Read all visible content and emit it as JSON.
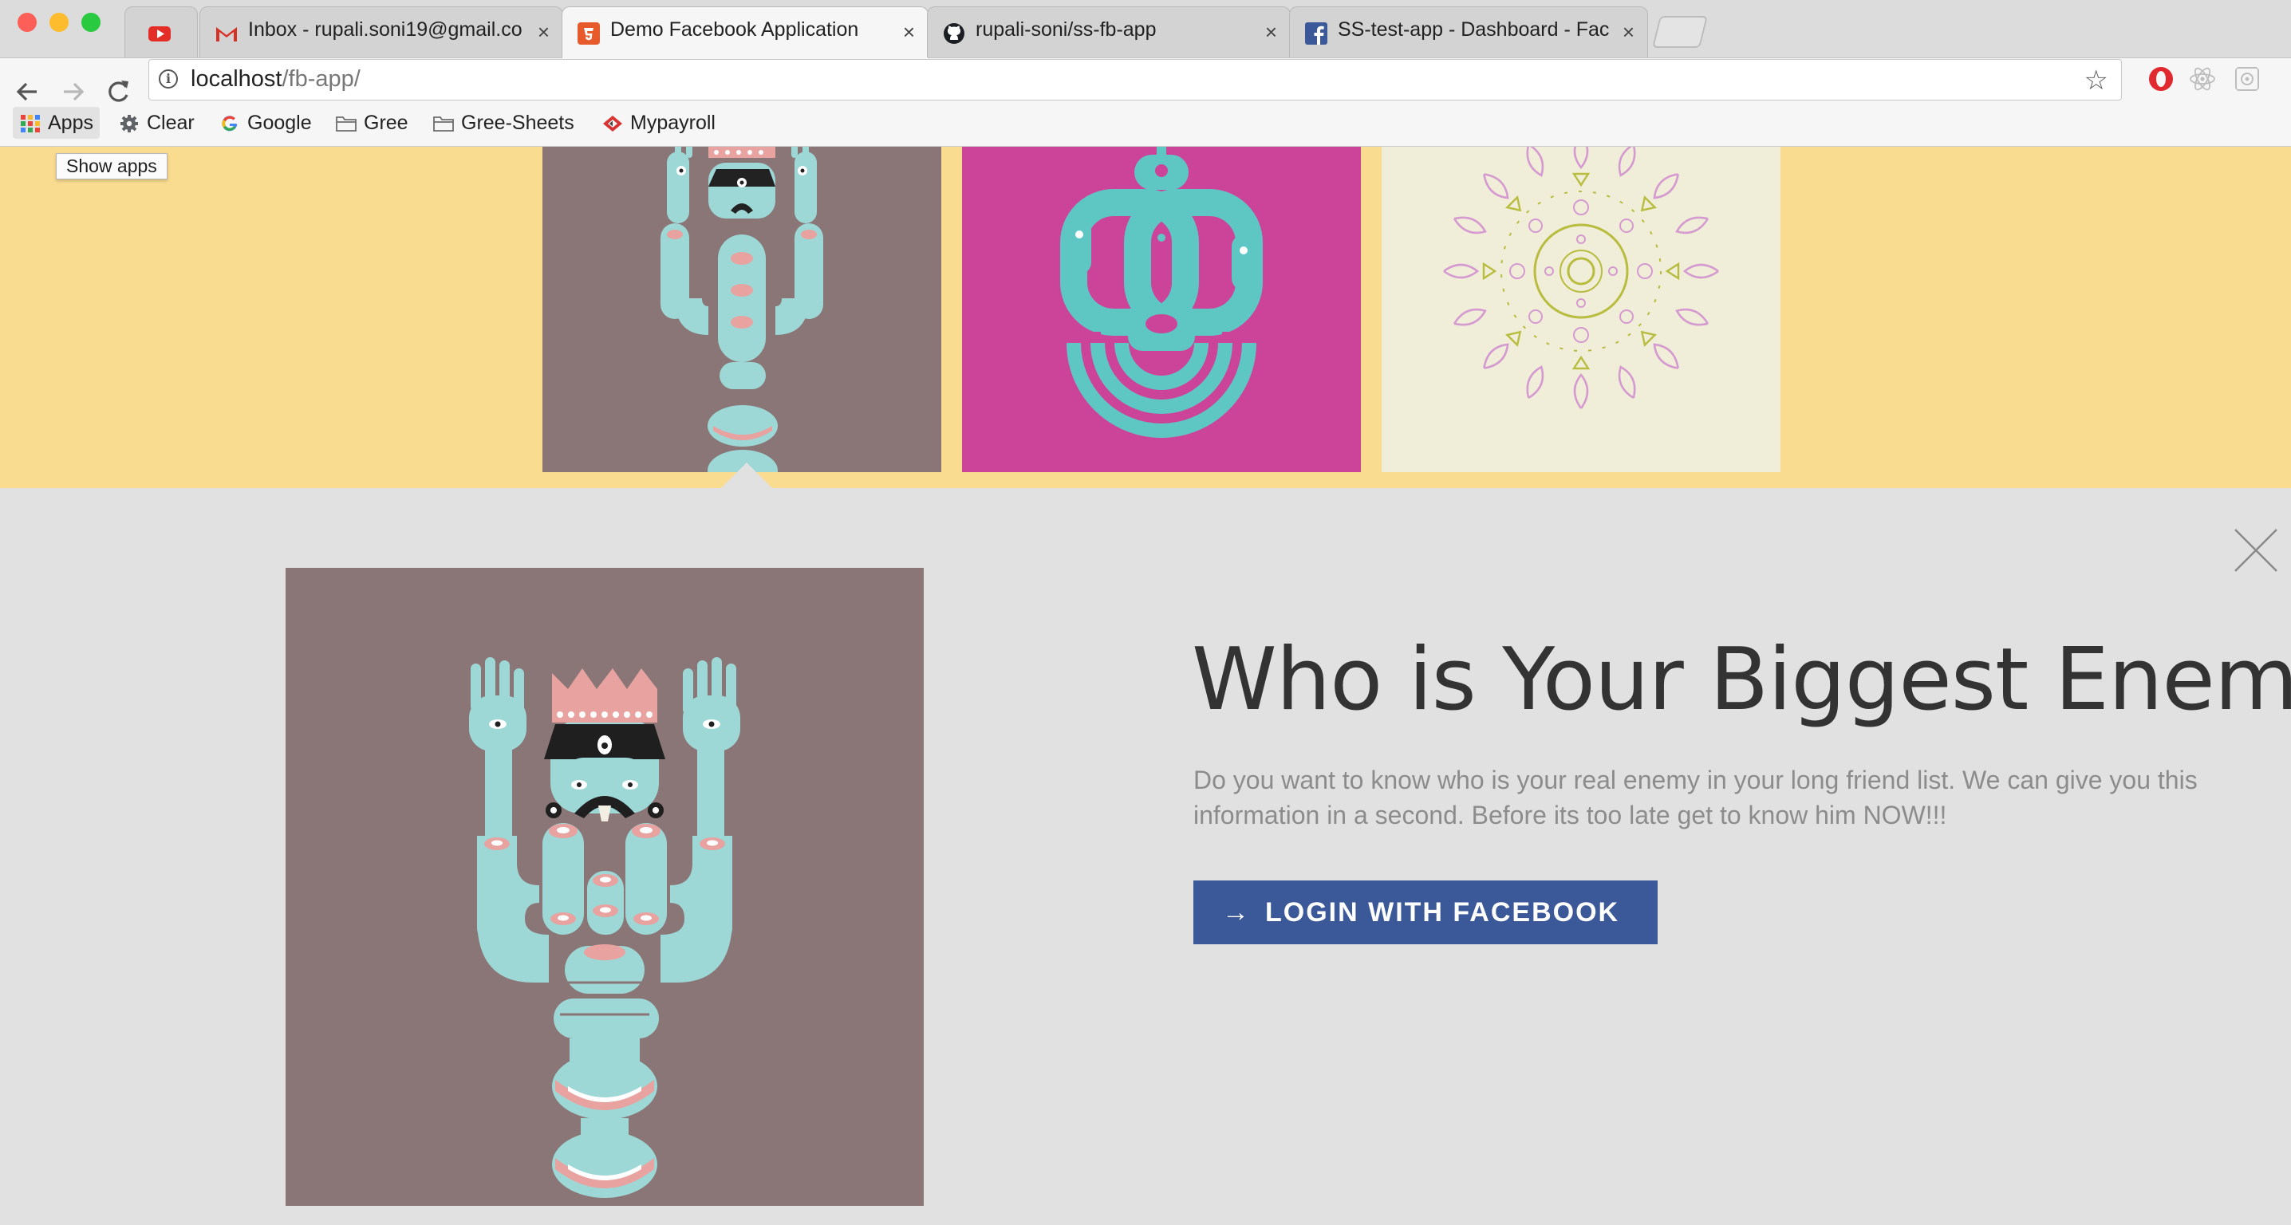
{
  "tabs": [
    {
      "title": "",
      "icon": "youtube-icon"
    },
    {
      "title": "Inbox - rupali.soni19@gmail.co",
      "icon": "gmail-icon"
    },
    {
      "title": "Demo Facebook Application",
      "icon": "html5-icon",
      "active": true
    },
    {
      "title": "rupali-soni/ss-fb-app",
      "icon": "github-icon"
    },
    {
      "title": "SS-test-app - Dashboard - Fac",
      "icon": "facebook-icon"
    }
  ],
  "tab_close": "×",
  "address_bar": {
    "host": "localhost",
    "path": "/fb-app/"
  },
  "bookmarks": [
    {
      "label": "Apps",
      "icon": "apps-grid-icon"
    },
    {
      "label": "Clear",
      "icon": "gear-icon"
    },
    {
      "label": "Google",
      "icon": "google-icon"
    },
    {
      "label": "Gree",
      "icon": "folder-icon"
    },
    {
      "label": "Gree-Sheets",
      "icon": "folder-icon"
    },
    {
      "label": "Mypayroll",
      "icon": "mypayroll-icon"
    }
  ],
  "tooltip": "Show apps",
  "gallery": [
    {
      "name": "totem-figure-gray",
      "bg": "#8a7676"
    },
    {
      "name": "totem-figure-magenta",
      "bg": "#cc4499"
    },
    {
      "name": "mandala-cream",
      "bg": "#f0eed8"
    }
  ],
  "detail": {
    "headline": "Who is Your Biggest Enemy?",
    "description": "Do you want to know who is your real enemy in your long friend list. We can give you this information in a second. Before its too late get to know him NOW!!!",
    "button_arrow": "→",
    "button_label": "LOGIN WITH FACEBOOK"
  },
  "colors": {
    "hero_bg": "#fadc91",
    "panel_bg": "#e1e1e1",
    "facebook_blue": "#3b5998",
    "figure_cyan": "#9dd7d6",
    "figure_pink": "#e8a3a0"
  }
}
